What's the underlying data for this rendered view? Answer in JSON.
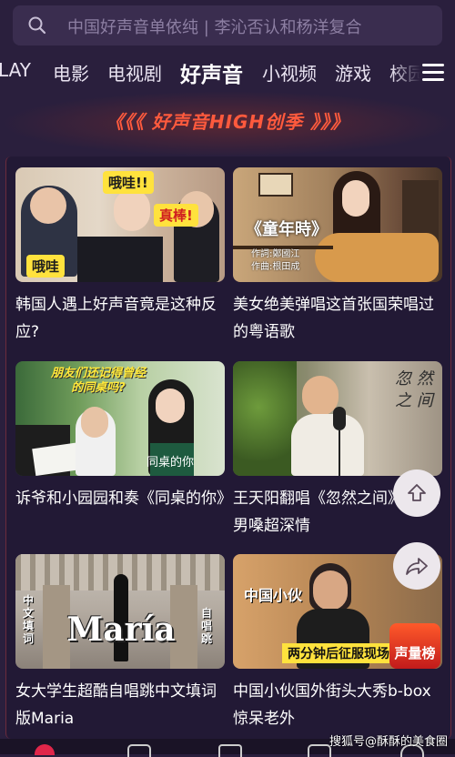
{
  "search": {
    "placeholder": "中国好声音单依纯 | 李沁否认和杨洋复合",
    "icon": "search-icon"
  },
  "tabs": [
    {
      "label": "LAY",
      "active": false
    },
    {
      "label": "电影",
      "active": false
    },
    {
      "label": "电视剧",
      "active": false
    },
    {
      "label": "好声音",
      "active": true
    },
    {
      "label": "小视频",
      "active": false
    },
    {
      "label": "游戏",
      "active": false
    },
    {
      "label": "校园",
      "active": false
    }
  ],
  "banner": {
    "left_chevrons": "《《《",
    "title": "好声音HIGH创季",
    "right_chevrons": "》》》"
  },
  "videos": [
    {
      "caption": "韩国人遇上好声音竟是这种反应?",
      "thumb_badges": [
        "哦哇!!",
        "真棒!",
        "哦哇"
      ]
    },
    {
      "caption": "美女绝美弹唱这首张国荣唱过的粤语歌",
      "thumb_title": "《童年時》",
      "thumb_credits": [
        "作詞:鄭國江",
        "作曲:根田成"
      ]
    },
    {
      "caption": "诉爷和小园园和奏《同桌的你》",
      "thumb_title": "朋友们还记得曾经的同桌吗?",
      "thumb_sub": "同桌的你"
    },
    {
      "caption": "王天阳翻唱《忽然之间》,沙哑男嗓超深情",
      "thumb_title": "忽 然 之 间"
    },
    {
      "caption": "女大学生超酷自唱跳中文填词版Maria",
      "thumb_title": "María",
      "thumb_left": "中文填词",
      "thumb_right": "自唱跳"
    },
    {
      "caption": "中国小伙国外街头大秀b-box惊呆老外",
      "thumb_title": "中国小伙",
      "thumb_sub": "两分钟后征服现场",
      "thumb_badge": "声量榜"
    }
  ],
  "watermark": "搜狐号@酥酥的美食圈",
  "colors": {
    "background": "#2a1f3d",
    "accent": "#ff5a3d",
    "search_bg": "#3a2d4f"
  }
}
